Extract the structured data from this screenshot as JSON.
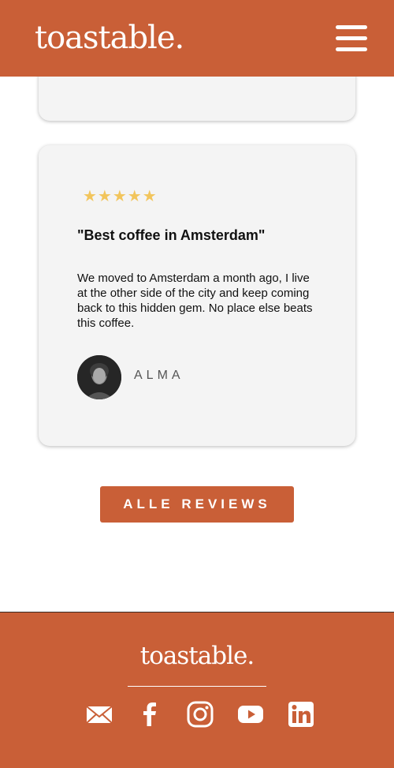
{
  "header": {
    "logo": "toastable.",
    "menu_icon": "hamburger-menu-icon"
  },
  "review": {
    "rating": 5,
    "stars": "★★★★★",
    "title": "\"Best coffee in Amsterdam\"",
    "text": "We moved to Amsterdam a month ago, I live at the other side of the city and keep coming back to this hidden gem. No place else beats this coffee.",
    "reviewer": "ALMA"
  },
  "cta": {
    "all_reviews": "ALLE REVIEWS"
  },
  "footer": {
    "logo": "toastable.",
    "social": [
      "mail-icon",
      "facebook-icon",
      "instagram-icon",
      "youtube-icon",
      "linkedin-icon"
    ]
  },
  "colors": {
    "brand": "#c95f37",
    "star": "#f2c55c",
    "card": "#f4f4f4"
  }
}
